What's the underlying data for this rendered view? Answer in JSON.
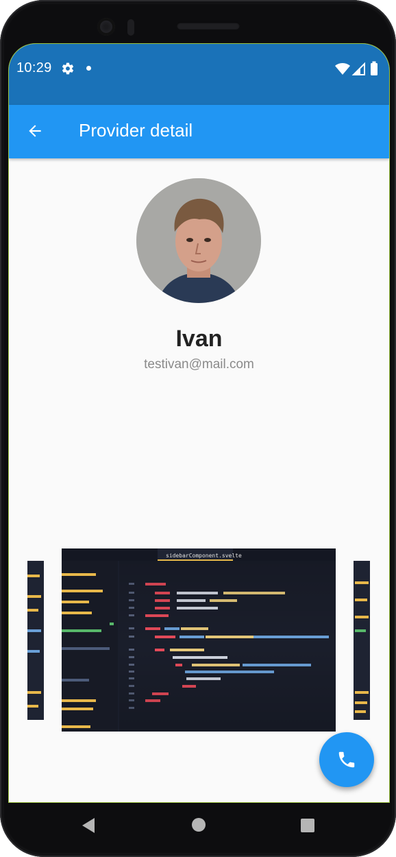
{
  "status_bar": {
    "time": "10:29",
    "icons": [
      "gear-icon",
      "notification-dot",
      "wifi-icon",
      "signal-icon",
      "battery-icon"
    ]
  },
  "app_bar": {
    "title": "Provider detail",
    "back_icon": "arrow-back-icon",
    "background": "#2196f3"
  },
  "profile": {
    "name": "Ivan",
    "email": "testivan@mail.com"
  },
  "carousel": {
    "items": [
      "code-screenshot-sidebarComponent"
    ],
    "code_tab": "sidebarComponent.svelte"
  },
  "fab": {
    "icon": "phone-icon",
    "color": "#2196f3"
  },
  "nav_bar": {
    "icons": [
      "back-triangle-icon",
      "home-circle-icon",
      "recents-square-icon"
    ]
  }
}
